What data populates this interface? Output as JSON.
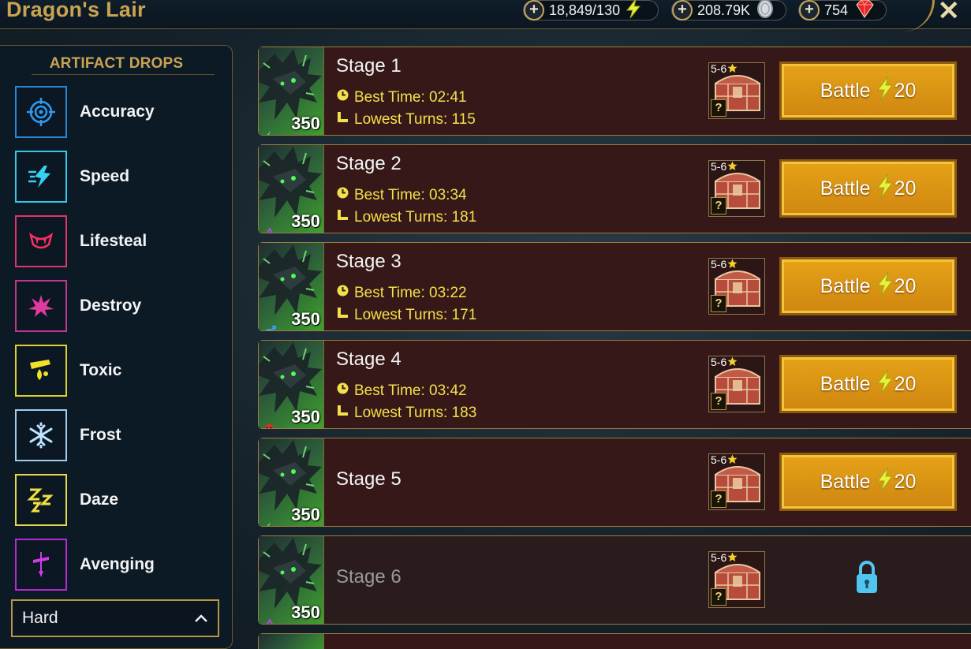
{
  "header": {
    "title": "Dragon's Lair",
    "resources": [
      {
        "value": "18,849/130",
        "icon": "energy-bolt-icon"
      },
      {
        "value": "208.79K",
        "icon": "silver-coin-icon"
      },
      {
        "value": "754",
        "icon": "gem-ruby-icon"
      }
    ],
    "close_icon": "close-icon"
  },
  "sidebar": {
    "title": "ARTIFACT DROPS",
    "sets": [
      {
        "label": "Accuracy",
        "color": "#2f82d6",
        "icon": "target-icon"
      },
      {
        "label": "Speed",
        "color": "#36c6e8",
        "icon": "speed-boot-icon"
      },
      {
        "label": "Lifesteal",
        "color": "#e2336b",
        "icon": "fangs-icon"
      },
      {
        "label": "Destroy",
        "color": "#c2358f",
        "icon": "burst-icon"
      },
      {
        "label": "Toxic",
        "color": "#e0d02a",
        "icon": "poison-drop-icon"
      },
      {
        "label": "Frost",
        "color": "#9fcdee",
        "icon": "snowflake-icon"
      },
      {
        "label": "Daze",
        "color": "#e5d94a",
        "icon": "zzz-icon"
      },
      {
        "label": "Avenging",
        "color": "#b42bd1",
        "icon": "sword-icon"
      }
    ],
    "difficulty": "Hard"
  },
  "stages": [
    {
      "name": "Stage 1",
      "power": "350",
      "affinity": "lightning",
      "best_time": "Best Time: 02:41",
      "lowest_turns": "Lowest Turns: 115",
      "rank": "5-6",
      "battle": "Battle",
      "cost": "20",
      "locked": false
    },
    {
      "name": "Stage 2",
      "power": "350",
      "affinity": "void",
      "best_time": "Best Time: 03:34",
      "lowest_turns": "Lowest Turns: 181",
      "rank": "5-6",
      "battle": "Battle",
      "cost": "20",
      "locked": false
    },
    {
      "name": "Stage 3",
      "power": "350",
      "affinity": "magic",
      "best_time": "Best Time: 03:22",
      "lowest_turns": "Lowest Turns: 171",
      "rank": "5-6",
      "battle": "Battle",
      "cost": "20",
      "locked": false
    },
    {
      "name": "Stage 4",
      "power": "350",
      "affinity": "force",
      "best_time": "Best Time: 03:42",
      "lowest_turns": "Lowest Turns: 183",
      "rank": "5-6",
      "battle": "Battle",
      "cost": "20",
      "locked": false
    },
    {
      "name": "Stage 5",
      "power": "350",
      "affinity": "lightning",
      "best_time": "",
      "lowest_turns": "",
      "rank": "5-6",
      "battle": "Battle",
      "cost": "20",
      "locked": false
    },
    {
      "name": "Stage 6",
      "power": "350",
      "affinity": "void",
      "best_time": "",
      "lowest_turns": "",
      "rank": "5-6",
      "battle": "",
      "cost": "",
      "locked": true
    }
  ]
}
